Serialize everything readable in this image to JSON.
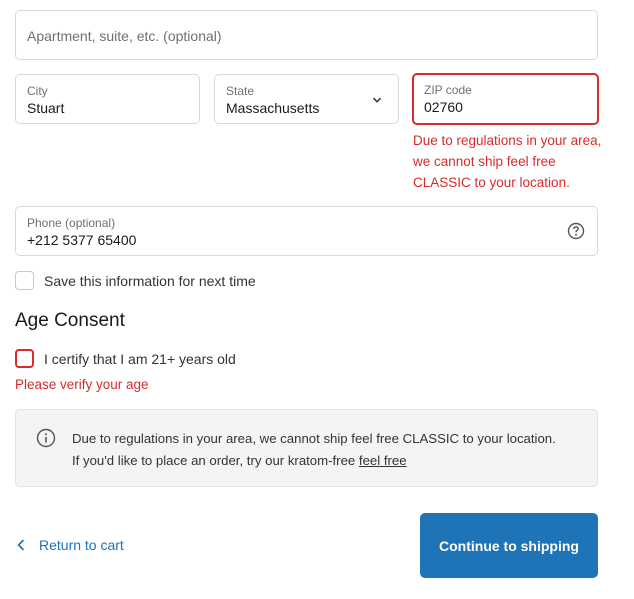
{
  "apartment": {
    "placeholder": "Apartment, suite, etc. (optional)"
  },
  "city": {
    "label": "City",
    "value": "Stuart"
  },
  "state": {
    "label": "State",
    "value": "Massachusetts"
  },
  "zip": {
    "label": "ZIP code",
    "value": "02760",
    "error": "Due to regulations in your area, we cannot ship feel free CLASSIC to your location."
  },
  "phone": {
    "label": "Phone (optional)",
    "value": "+212 5377 65400"
  },
  "save_info": {
    "label": "Save this information for next time"
  },
  "age_consent": {
    "title": "Age Consent",
    "checkbox_label": "I certify that I am 21+ years old",
    "error": "Please verify your age"
  },
  "notice": {
    "line1": "Due to regulations in your area, we cannot ship feel free CLASSIC to your location.",
    "line2_prefix": "If you'd like to place an order, try our kratom-free",
    "link": "feel free"
  },
  "footer": {
    "return_label": "Return to cart",
    "continue_label": "Continue to shipping"
  },
  "colors": {
    "accent": "#1f73b7",
    "error": "#d72c2c",
    "notice_bg": "#f4f4f4"
  }
}
